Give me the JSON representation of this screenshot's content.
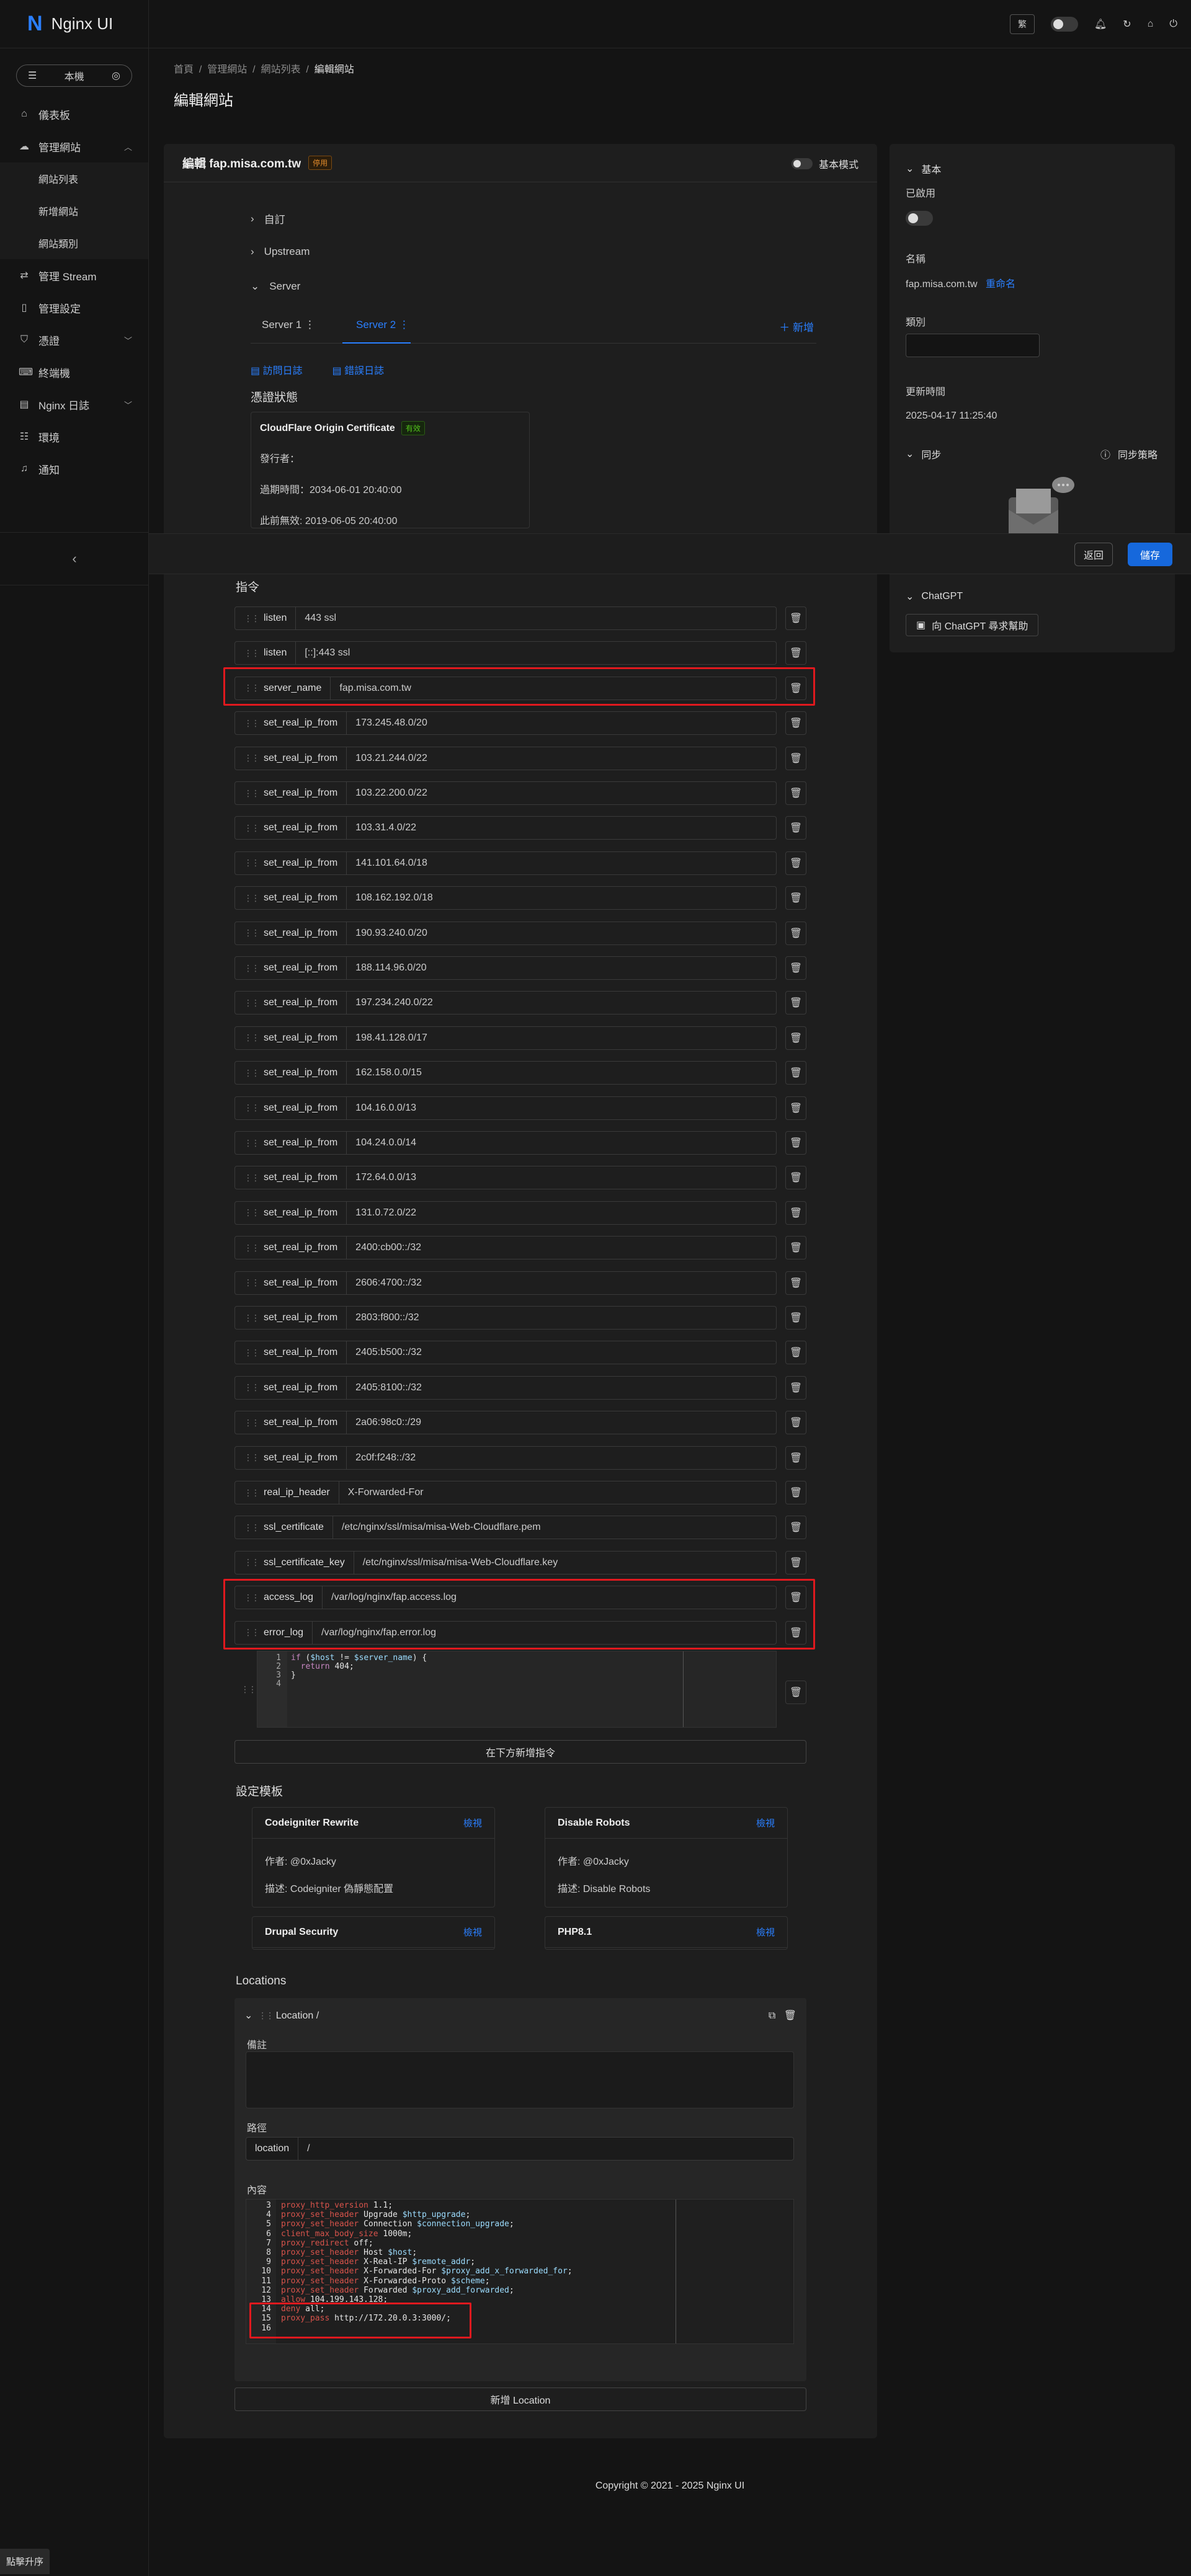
{
  "app": {
    "name": "Nginx UI",
    "logo_letter": "N"
  },
  "env_select": "本機",
  "sidebar": {
    "items": [
      {
        "label": "儀表板",
        "icon": "home-icon"
      },
      {
        "label": "管理網站",
        "icon": "cloud-icon"
      },
      {
        "label": "網站列表",
        "sub": true
      },
      {
        "label": "新增網站",
        "sub": true
      },
      {
        "label": "網站類別",
        "sub": true
      },
      {
        "label": "管理 Stream",
        "icon": "share-icon"
      },
      {
        "label": "管理設定",
        "icon": "file-icon"
      },
      {
        "label": "憑證",
        "icon": "shield-icon"
      },
      {
        "label": "終端機",
        "icon": "terminal-icon"
      },
      {
        "label": "Nginx 日誌",
        "icon": "file-text-icon"
      },
      {
        "label": "環境",
        "icon": "database-icon"
      },
      {
        "label": "通知",
        "icon": "bell-icon"
      }
    ]
  },
  "topbar": {
    "lang": "繁"
  },
  "breadcrumb": {
    "items": [
      "首頁",
      "管理網站",
      "網站列表",
      "編輯網站"
    ]
  },
  "page_title": "編輯網站",
  "editor": {
    "title": "編輯 fap.misa.com.tw",
    "badge": "停用",
    "basic_mode": "基本模式",
    "sections": [
      "自訂",
      "Upstream",
      "Server"
    ],
    "tabs": [
      "Server 1",
      "Server 2"
    ],
    "add_label": "新增",
    "access_log_link": "訪問日誌",
    "error_log_link": "錯誤日誌",
    "cert_heading": "憑證狀態",
    "cert": {
      "name": "CloudFlare Origin Certificate",
      "status": "有效",
      "issuer": "發行者：",
      "expire": "過期時間：2034-06-01 20:40:00",
      "not_before": "此前無效: 2019-06-05 20:40:00"
    },
    "directives_heading": "指令",
    "directives": [
      {
        "k": "listen",
        "v": "443 ssl"
      },
      {
        "k": "listen",
        "v": "[::]:443 ssl"
      },
      {
        "k": "server_name",
        "v": "fap.misa.com.tw"
      },
      {
        "k": "set_real_ip_from",
        "v": "173.245.48.0/20"
      },
      {
        "k": "set_real_ip_from",
        "v": "103.21.244.0/22"
      },
      {
        "k": "set_real_ip_from",
        "v": "103.22.200.0/22"
      },
      {
        "k": "set_real_ip_from",
        "v": "103.31.4.0/22"
      },
      {
        "k": "set_real_ip_from",
        "v": "141.101.64.0/18"
      },
      {
        "k": "set_real_ip_from",
        "v": "108.162.192.0/18"
      },
      {
        "k": "set_real_ip_from",
        "v": "190.93.240.0/20"
      },
      {
        "k": "set_real_ip_from",
        "v": "188.114.96.0/20"
      },
      {
        "k": "set_real_ip_from",
        "v": "197.234.240.0/22"
      },
      {
        "k": "set_real_ip_from",
        "v": "198.41.128.0/17"
      },
      {
        "k": "set_real_ip_from",
        "v": "162.158.0.0/15"
      },
      {
        "k": "set_real_ip_from",
        "v": "104.16.0.0/13"
      },
      {
        "k": "set_real_ip_from",
        "v": "104.24.0.0/14"
      },
      {
        "k": "set_real_ip_from",
        "v": "172.64.0.0/13"
      },
      {
        "k": "set_real_ip_from",
        "v": "131.0.72.0/22"
      },
      {
        "k": "set_real_ip_from",
        "v": "2400:cb00::/32"
      },
      {
        "k": "set_real_ip_from",
        "v": "2606:4700::/32"
      },
      {
        "k": "set_real_ip_from",
        "v": "2803:f800::/32"
      },
      {
        "k": "set_real_ip_from",
        "v": "2405:b500::/32"
      },
      {
        "k": "set_real_ip_from",
        "v": "2405:8100::/32"
      },
      {
        "k": "set_real_ip_from",
        "v": "2a06:98c0::/29"
      },
      {
        "k": "set_real_ip_from",
        "v": "2c0f:f248::/32"
      },
      {
        "k": "real_ip_header",
        "v": "X-Forwarded-For"
      },
      {
        "k": "ssl_certificate",
        "v": "/etc/nginx/ssl/misa/misa-Web-Cloudflare.pem"
      },
      {
        "k": "ssl_certificate_key",
        "v": "/etc/nginx/ssl/misa/misa-Web-Cloudflare.key"
      },
      {
        "k": "access_log",
        "v": "/var/log/nginx/fap.access.log"
      },
      {
        "k": "error_log",
        "v": "/var/log/nginx/fap.error.log"
      }
    ],
    "add_directive": "在下方新增指令",
    "templates_heading": "設定模板",
    "templates": [
      {
        "name": "Codeigniter Rewrite",
        "view": "檢視",
        "author": "作者: @0xJacky",
        "desc": "描述: Codeigniter 偽靜態配置"
      },
      {
        "name": "Disable Robots",
        "view": "檢視",
        "author": "作者: @0xJacky",
        "desc": "描述: Disable Robots"
      },
      {
        "name": "Drupal Security",
        "view": "檢視"
      },
      {
        "name": "PHP8.1",
        "view": "檢視"
      }
    ],
    "locations_heading": "Locations",
    "location": {
      "title": "Location /",
      "comment_label": "備註",
      "path_label": "路徑",
      "path_key": "location",
      "path_value": "/",
      "content_label": "內容"
    },
    "add_location": "新增 Location"
  },
  "savebar": {
    "back": "返回",
    "save": "儲存"
  },
  "right": {
    "basic": "基本",
    "enabled": "已啟用",
    "name_label": "名稱",
    "name_value": "fap.misa.com.tw",
    "rename": "重命名",
    "category": "類別",
    "updated_label": "更新時間",
    "updated_value": "2025-04-17 11:25:40",
    "sync": "同步",
    "sync_policy": "同步策略",
    "chatgpt": "ChatGPT",
    "chatgpt_btn": "向 ChatGPT 尋求幫助"
  },
  "copyright": "Copyright © 2021 - 2025 Nginx UI",
  "footer_badge": "點擊升序"
}
